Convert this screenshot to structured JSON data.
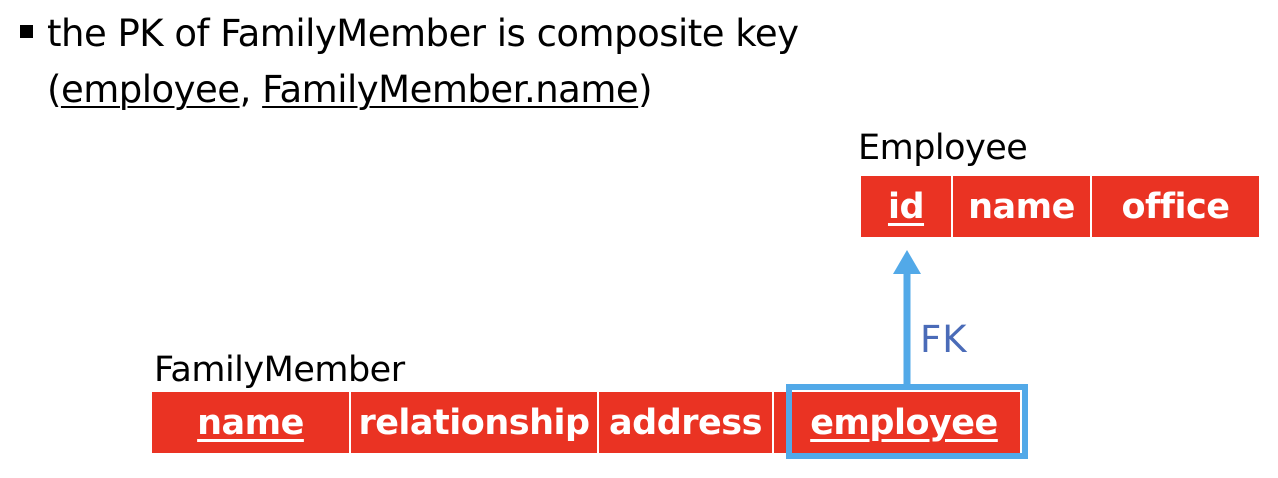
{
  "bullet": {
    "line1": "the PK of FamilyMember is composite key",
    "line2_open": "(",
    "line2_key1": "employee",
    "line2_sep": ", ",
    "line2_key2": "FamilyMember.name",
    "line2_close": ")"
  },
  "employee_table": {
    "label": "Employee",
    "columns": [
      "id",
      "name",
      "office"
    ]
  },
  "family_member_table": {
    "label": "FamilyMember",
    "columns": [
      "name",
      "relationship",
      "address",
      "employee"
    ]
  },
  "relation": {
    "label": "FK"
  },
  "colors": {
    "cell_fill": "#ea3323",
    "highlight": "#52a9e8",
    "fk_text": "#4a6bb8"
  }
}
